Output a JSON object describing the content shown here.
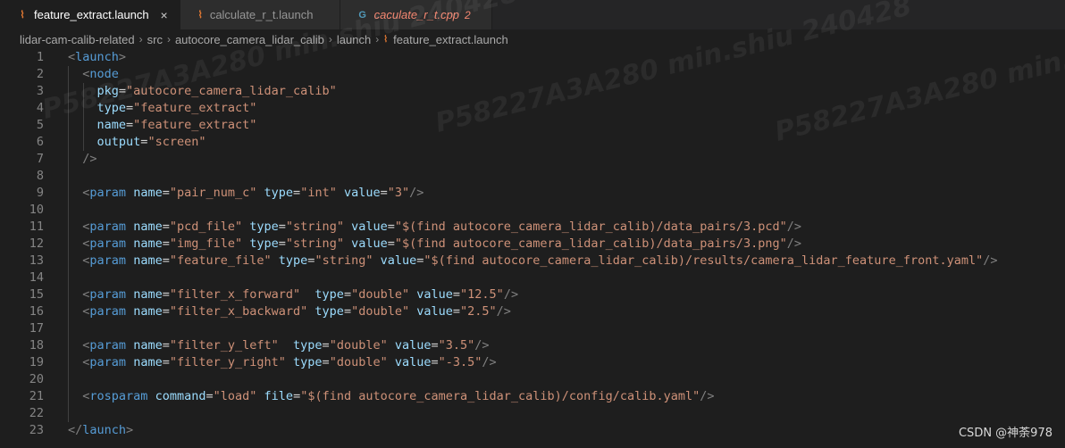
{
  "tabs": [
    {
      "label": "feature_extract.launch",
      "icon": "rss-icon",
      "active": true
    },
    {
      "label": "calculate_r_t.launch",
      "icon": "rss-icon",
      "active": false
    },
    {
      "label": "caculate_r_t.cpp",
      "icon": "cpp-icon",
      "active": false,
      "badge": "2"
    }
  ],
  "icons": {
    "close": "×",
    "rss": "⌇",
    "cpp": "G"
  },
  "breadcrumb": [
    "lidar-cam-calib-related",
    "src",
    "autocore_camera_lidar_calib",
    "launch",
    "feature_extract.launch"
  ],
  "lines": [
    [
      [
        "punc",
        "<"
      ],
      [
        "tag",
        "launch"
      ],
      [
        "punc",
        ">"
      ]
    ],
    [
      [
        "txt",
        "  "
      ],
      [
        "punc",
        "<"
      ],
      [
        "tag",
        "node"
      ]
    ],
    [
      [
        "txt",
        "    "
      ],
      [
        "attr",
        "pkg"
      ],
      [
        "txt",
        "="
      ],
      [
        "str",
        "\"autocore_camera_lidar_calib\""
      ]
    ],
    [
      [
        "txt",
        "    "
      ],
      [
        "attr",
        "type"
      ],
      [
        "txt",
        "="
      ],
      [
        "str",
        "\"feature_extract\""
      ]
    ],
    [
      [
        "txt",
        "    "
      ],
      [
        "attr",
        "name"
      ],
      [
        "txt",
        "="
      ],
      [
        "str",
        "\"feature_extract\""
      ]
    ],
    [
      [
        "txt",
        "    "
      ],
      [
        "attr",
        "output"
      ],
      [
        "txt",
        "="
      ],
      [
        "str",
        "\"screen\""
      ]
    ],
    [
      [
        "txt",
        "  "
      ],
      [
        "punc",
        "/>"
      ]
    ],
    [],
    [
      [
        "txt",
        "  "
      ],
      [
        "punc",
        "<"
      ],
      [
        "tag",
        "param"
      ],
      [
        "txt",
        " "
      ],
      [
        "attr",
        "name"
      ],
      [
        "txt",
        "="
      ],
      [
        "str",
        "\"pair_num_c\""
      ],
      [
        "txt",
        " "
      ],
      [
        "attr",
        "type"
      ],
      [
        "txt",
        "="
      ],
      [
        "str",
        "\"int\""
      ],
      [
        "txt",
        " "
      ],
      [
        "attr",
        "value"
      ],
      [
        "txt",
        "="
      ],
      [
        "str",
        "\"3\""
      ],
      [
        "punc",
        "/>"
      ]
    ],
    [],
    [
      [
        "txt",
        "  "
      ],
      [
        "punc",
        "<"
      ],
      [
        "tag",
        "param"
      ],
      [
        "txt",
        " "
      ],
      [
        "attr",
        "name"
      ],
      [
        "txt",
        "="
      ],
      [
        "str",
        "\"pcd_file\""
      ],
      [
        "txt",
        " "
      ],
      [
        "attr",
        "type"
      ],
      [
        "txt",
        "="
      ],
      [
        "str",
        "\"string\""
      ],
      [
        "txt",
        " "
      ],
      [
        "attr",
        "value"
      ],
      [
        "txt",
        "="
      ],
      [
        "str",
        "\"$(find autocore_camera_lidar_calib)/data_pairs/3.pcd\""
      ],
      [
        "punc",
        "/>"
      ]
    ],
    [
      [
        "txt",
        "  "
      ],
      [
        "punc",
        "<"
      ],
      [
        "tag",
        "param"
      ],
      [
        "txt",
        " "
      ],
      [
        "attr",
        "name"
      ],
      [
        "txt",
        "="
      ],
      [
        "str",
        "\"img_file\""
      ],
      [
        "txt",
        " "
      ],
      [
        "attr",
        "type"
      ],
      [
        "txt",
        "="
      ],
      [
        "str",
        "\"string\""
      ],
      [
        "txt",
        " "
      ],
      [
        "attr",
        "value"
      ],
      [
        "txt",
        "="
      ],
      [
        "str",
        "\"$(find autocore_camera_lidar_calib)/data_pairs/3.png\""
      ],
      [
        "punc",
        "/>"
      ]
    ],
    [
      [
        "txt",
        "  "
      ],
      [
        "punc",
        "<"
      ],
      [
        "tag",
        "param"
      ],
      [
        "txt",
        " "
      ],
      [
        "attr",
        "name"
      ],
      [
        "txt",
        "="
      ],
      [
        "str",
        "\"feature_file\""
      ],
      [
        "txt",
        " "
      ],
      [
        "attr",
        "type"
      ],
      [
        "txt",
        "="
      ],
      [
        "str",
        "\"string\""
      ],
      [
        "txt",
        " "
      ],
      [
        "attr",
        "value"
      ],
      [
        "txt",
        "="
      ],
      [
        "str",
        "\"$(find autocore_camera_lidar_calib)/results/camera_lidar_feature_front.yaml\""
      ],
      [
        "punc",
        "/>"
      ]
    ],
    [],
    [
      [
        "txt",
        "  "
      ],
      [
        "punc",
        "<"
      ],
      [
        "tag",
        "param"
      ],
      [
        "txt",
        " "
      ],
      [
        "attr",
        "name"
      ],
      [
        "txt",
        "="
      ],
      [
        "str",
        "\"filter_x_forward\""
      ],
      [
        "txt",
        "  "
      ],
      [
        "attr",
        "type"
      ],
      [
        "txt",
        "="
      ],
      [
        "str",
        "\"double\""
      ],
      [
        "txt",
        " "
      ],
      [
        "attr",
        "value"
      ],
      [
        "txt",
        "="
      ],
      [
        "str",
        "\"12.5\""
      ],
      [
        "punc",
        "/>"
      ]
    ],
    [
      [
        "txt",
        "  "
      ],
      [
        "punc",
        "<"
      ],
      [
        "tag",
        "param"
      ],
      [
        "txt",
        " "
      ],
      [
        "attr",
        "name"
      ],
      [
        "txt",
        "="
      ],
      [
        "str",
        "\"filter_x_backward\""
      ],
      [
        "txt",
        " "
      ],
      [
        "attr",
        "type"
      ],
      [
        "txt",
        "="
      ],
      [
        "str",
        "\"double\""
      ],
      [
        "txt",
        " "
      ],
      [
        "attr",
        "value"
      ],
      [
        "txt",
        "="
      ],
      [
        "str",
        "\"2.5\""
      ],
      [
        "punc",
        "/>"
      ]
    ],
    [],
    [
      [
        "txt",
        "  "
      ],
      [
        "punc",
        "<"
      ],
      [
        "tag",
        "param"
      ],
      [
        "txt",
        " "
      ],
      [
        "attr",
        "name"
      ],
      [
        "txt",
        "="
      ],
      [
        "str",
        "\"filter_y_left\""
      ],
      [
        "txt",
        "  "
      ],
      [
        "attr",
        "type"
      ],
      [
        "txt",
        "="
      ],
      [
        "str",
        "\"double\""
      ],
      [
        "txt",
        " "
      ],
      [
        "attr",
        "value"
      ],
      [
        "txt",
        "="
      ],
      [
        "str",
        "\"3.5\""
      ],
      [
        "punc",
        "/>"
      ]
    ],
    [
      [
        "txt",
        "  "
      ],
      [
        "punc",
        "<"
      ],
      [
        "tag",
        "param"
      ],
      [
        "txt",
        " "
      ],
      [
        "attr",
        "name"
      ],
      [
        "txt",
        "="
      ],
      [
        "str",
        "\"filter_y_right\""
      ],
      [
        "txt",
        " "
      ],
      [
        "attr",
        "type"
      ],
      [
        "txt",
        "="
      ],
      [
        "str",
        "\"double\""
      ],
      [
        "txt",
        " "
      ],
      [
        "attr",
        "value"
      ],
      [
        "txt",
        "="
      ],
      [
        "str",
        "\"-3.5\""
      ],
      [
        "punc",
        "/>"
      ]
    ],
    [],
    [
      [
        "txt",
        "  "
      ],
      [
        "punc",
        "<"
      ],
      [
        "tag",
        "rosparam"
      ],
      [
        "txt",
        " "
      ],
      [
        "attr",
        "command"
      ],
      [
        "txt",
        "="
      ],
      [
        "str",
        "\"load\""
      ],
      [
        "txt",
        " "
      ],
      [
        "attr",
        "file"
      ],
      [
        "txt",
        "="
      ],
      [
        "str",
        "\"$(find autocore_camera_lidar_calib)/config/calib.yaml\""
      ],
      [
        "punc",
        "/>"
      ]
    ],
    [],
    [
      [
        "punc",
        "</"
      ],
      [
        "tag",
        "launch"
      ],
      [
        "punc",
        ">"
      ]
    ]
  ],
  "watermark": "P58227A3A280 min.shiu 240428",
  "credit": "CSDN @神荼978",
  "colors": {
    "tag": "#569cd6",
    "attr": "#9cdcfe",
    "str": "#ce9178",
    "punc": "#808080",
    "bg": "#1e1e1e"
  }
}
